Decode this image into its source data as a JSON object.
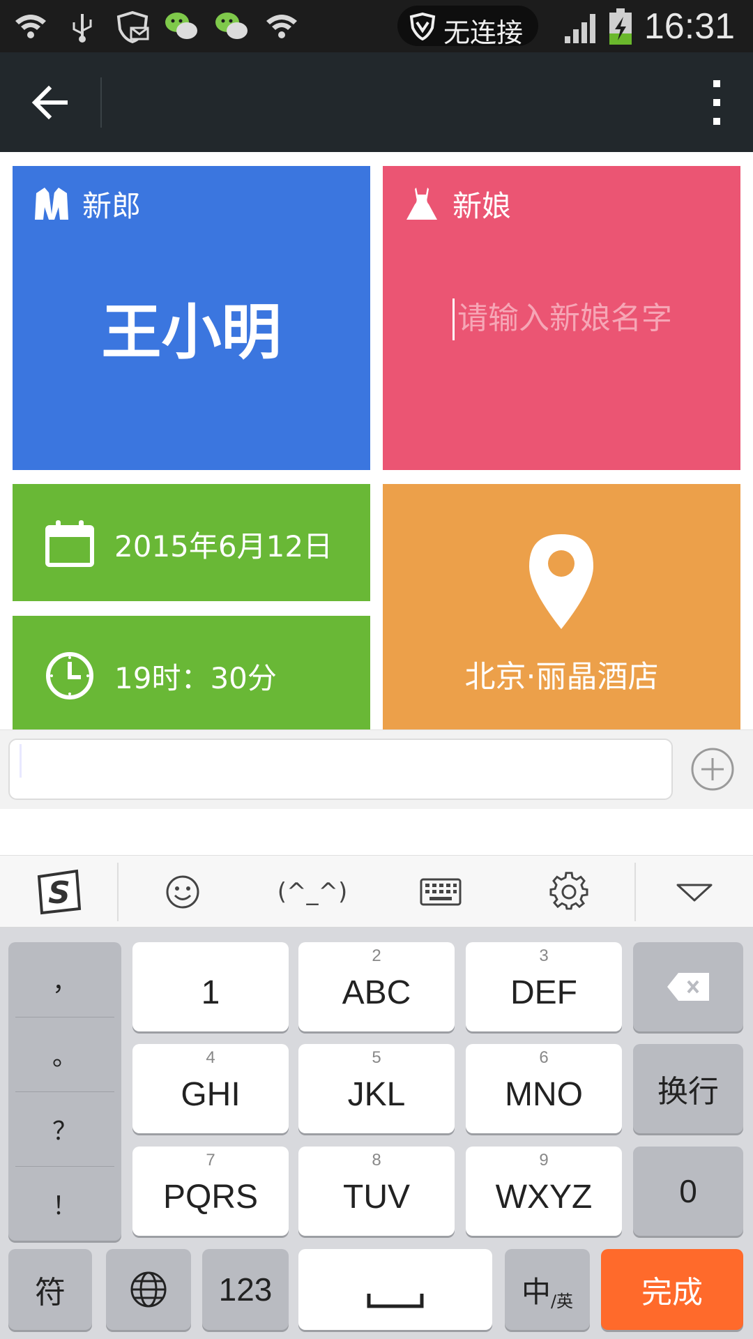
{
  "status_bar": {
    "network_label": "无连接",
    "time": "16:31",
    "icons": [
      "wifi-icon",
      "usb-icon",
      "shield-mail-icon",
      "wechat-icon",
      "wechat-icon",
      "wifi-icon",
      "shield-icon",
      "signal-icon",
      "battery-charging-icon"
    ]
  },
  "appbar": {
    "back_icon": "arrow-left-icon",
    "more_icon": "more-vertical-icon"
  },
  "tiles": {
    "groom": {
      "label": "新郎",
      "name": "王小明",
      "color": "#3b76df"
    },
    "bride": {
      "label": "新娘",
      "placeholder": "请输入新娘名字",
      "color": "#eb5573"
    },
    "date": {
      "text": "2015年6月12日",
      "color": "#69b836"
    },
    "time": {
      "text": "19时：30分",
      "color": "#69b836"
    },
    "place": {
      "text": "北京·丽晶酒店",
      "color": "#eca04a"
    }
  },
  "input_bar": {
    "value": "",
    "plus_icon": "plus-circle-icon"
  },
  "keyboard_toolbar": {
    "items": [
      "sogou-logo-icon",
      "emoji-icon",
      "(^_^)",
      "keyboard-icon",
      "gear-icon",
      "chevron-down-icon"
    ],
    "kaomoji": "(^_^)"
  },
  "keyboard": {
    "punctuation": [
      "，",
      "。",
      "？",
      "！"
    ],
    "keys": [
      {
        "num": "",
        "label": "1"
      },
      {
        "num": "2",
        "label": "ABC"
      },
      {
        "num": "3",
        "label": "DEF"
      },
      {
        "num": "4",
        "label": "GHI"
      },
      {
        "num": "5",
        "label": "JKL"
      },
      {
        "num": "6",
        "label": "MNO"
      },
      {
        "num": "7",
        "label": "PQRS"
      },
      {
        "num": "8",
        "label": "TUV"
      },
      {
        "num": "9",
        "label": "WXYZ"
      }
    ],
    "newline": "换行",
    "zero": "0",
    "symbols": "符",
    "num_mode": "123",
    "lang_main": "中",
    "lang_sub": "/英",
    "done": "完成",
    "done_color": "#ff6a2b"
  }
}
